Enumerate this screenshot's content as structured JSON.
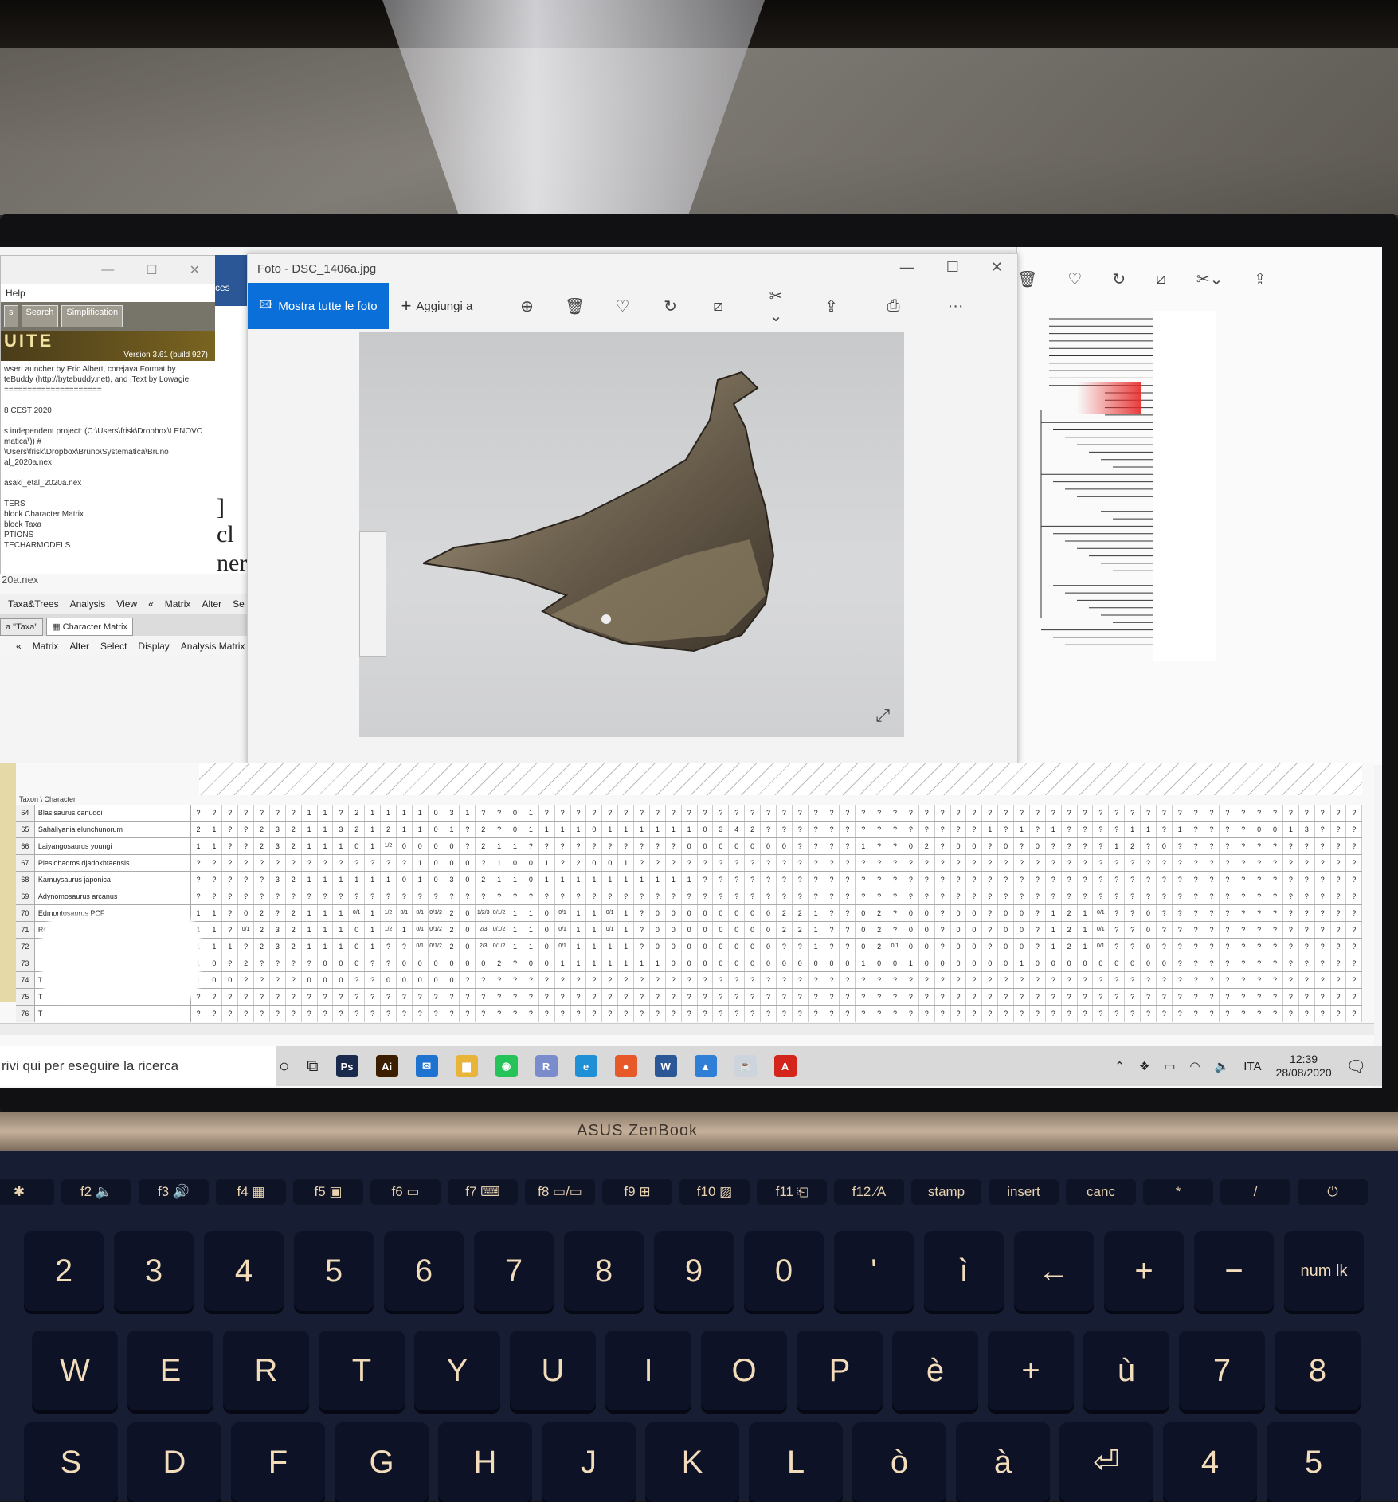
{
  "photo_viewer": {
    "title": "Foto - DSC_1406a.jpg",
    "show_all_label": "Mostra tutte le foto",
    "add_to_label": "Aggiungi a",
    "more": "···"
  },
  "mesquite": {
    "menu_help": "Help",
    "tabs": [
      "s",
      "Search",
      "Simplification"
    ],
    "banner": "UITE",
    "version": "Version 3.61  (build 927)",
    "log_lines": [
      "wserLauncher by Eric Albert,  corejava.Format by",
      "teBuddy (http://bytebuddy.net), and iText by Lowagie",
      "=====================",
      "",
      "8 CEST 2020",
      "",
      "s independent project: (C:\\Users\\frisk\\Dropbox\\LENOVO",
      "matica\\)) #",
      "\\Users\\frisk\\Dropbox\\Bruno\\Systematica\\Bruno",
      "al_2020a.nex",
      "",
      "asaki_etal_2020a.nex",
      "",
      "TERS",
      "block Character Matrix",
      "block Taxa",
      "PTIONS",
      "TECHARMODELS"
    ],
    "file_name": "20a.nex",
    "menubar": [
      "Taxa&Trees",
      "Analysis",
      "View",
      "«",
      "Matrix",
      "Alter",
      "Se"
    ],
    "tab_taxa": "a \"Taxa\"",
    "tab_matrix": "Character Matrix",
    "submenu": [
      "«",
      "Matrix",
      "Alter",
      "Select",
      "Display",
      "Analysis Matrix"
    ],
    "header": "Taxon \\ Character"
  },
  "word": {
    "ribbon_text": "ces",
    "fragments": [
      "] cl",
      "nera"
    ]
  },
  "matrix_rows": [
    {
      "num": "64",
      "taxon": "Blasisaurus canudoi",
      "cells": [
        "?",
        "?",
        "?",
        "?",
        "?",
        "?",
        "?",
        "1",
        "1",
        "?",
        "2",
        "1",
        "1",
        "1",
        "1",
        "0",
        "3",
        "1",
        "?",
        "?",
        "0",
        "1",
        "?",
        "?",
        "?",
        "?",
        "?",
        "?",
        "?",
        "?",
        "?",
        "?",
        "?",
        "?",
        "?",
        "?",
        "?",
        "?",
        "?",
        "?",
        "?",
        "?",
        "?",
        "?",
        "?",
        "?",
        "?",
        "?",
        "?",
        "?",
        "?",
        "?",
        "?",
        "?",
        "?",
        "?",
        "?",
        "?",
        "?",
        "?",
        "?",
        "?",
        "?",
        "?",
        "?",
        "?",
        "?",
        "?",
        "?",
        "?",
        "?",
        "?",
        "?",
        "?"
      ]
    },
    {
      "num": "65",
      "taxon": "Sahaliyania elunchunorum",
      "cells": [
        "2",
        "1",
        "?",
        "?",
        "2",
        "3",
        "2",
        "1",
        "1",
        "3",
        "2",
        "1",
        "2",
        "1",
        "1",
        "0",
        "1",
        "?",
        "2",
        "?",
        "0",
        "1",
        "1",
        "1",
        "1",
        "0",
        "1",
        "1",
        "1",
        "1",
        "1",
        "1",
        "0",
        "3",
        "4",
        "2",
        "?",
        "?",
        "?",
        "?",
        "?",
        "?",
        "?",
        "?",
        "?",
        "?",
        "?",
        "?",
        "?",
        "?",
        "1",
        "?",
        "1",
        "?",
        "1",
        "?",
        "?",
        "?",
        "?",
        "1",
        "1",
        "?",
        "1",
        "?",
        "?",
        "?",
        "?",
        "0",
        "0",
        "1",
        "3",
        "?",
        "?",
        "?"
      ]
    },
    {
      "num": "66",
      "taxon": "Laiyangosaurus youngi",
      "cells": [
        "1",
        "1",
        "?",
        "?",
        "2",
        "3",
        "2",
        "1",
        "1",
        "1",
        "0",
        "1",
        "1/2",
        "0",
        "0",
        "0",
        "0",
        "?",
        "2",
        "1",
        "1",
        "?",
        "?",
        "?",
        "?",
        "?",
        "?",
        "?",
        "?",
        "?",
        "?",
        "0",
        "0",
        "0",
        "0",
        "0",
        "0",
        "0",
        "?",
        "?",
        "?",
        "?",
        "1",
        "?",
        "?",
        "0",
        "2",
        "?",
        "0",
        "0",
        "?",
        "0",
        "?",
        "0",
        "?",
        "?",
        "?",
        "?",
        "1",
        "2",
        "?",
        "0",
        "?",
        "?",
        "?",
        "?",
        "?",
        "?",
        "?",
        "?",
        "?",
        "?",
        "?",
        "?"
      ]
    },
    {
      "num": "67",
      "taxon": "Plesiohadros djadokhtaensis",
      "cells": [
        "?",
        "?",
        "?",
        "?",
        "?",
        "?",
        "?",
        "?",
        "?",
        "?",
        "?",
        "?",
        "?",
        "?",
        "1",
        "0",
        "0",
        "0",
        "?",
        "1",
        "0",
        "0",
        "1",
        "?",
        "2",
        "0",
        "0",
        "1",
        "?",
        "?",
        "?",
        "?",
        "?",
        "?",
        "?",
        "?",
        "?",
        "?",
        "?",
        "?",
        "?",
        "?",
        "?",
        "?",
        "?",
        "?",
        "?",
        "?",
        "?",
        "?",
        "?",
        "?",
        "?",
        "?",
        "?",
        "?",
        "?",
        "?",
        "?",
        "?",
        "?",
        "?",
        "?",
        "?",
        "?",
        "?",
        "?",
        "?",
        "?",
        "?",
        "?",
        "?",
        "?",
        "?"
      ]
    },
    {
      "num": "68",
      "taxon": "Kamuysaurus japonica",
      "cells": [
        "?",
        "?",
        "?",
        "?",
        "?",
        "3",
        "2",
        "1",
        "1",
        "1",
        "1",
        "1",
        "1",
        "0",
        "1",
        "0",
        "3",
        "0",
        "2",
        "1",
        "1",
        "0",
        "1",
        "1",
        "1",
        "1",
        "1",
        "1",
        "1",
        "1",
        "1",
        "1",
        "?",
        "?",
        "?",
        "?",
        "?",
        "?",
        "?",
        "?",
        "?",
        "?",
        "?",
        "?",
        "?",
        "?",
        "?",
        "?",
        "?",
        "?",
        "?",
        "?",
        "?",
        "?",
        "?",
        "?",
        "?",
        "?",
        "?",
        "?",
        "?",
        "?",
        "?",
        "?",
        "?",
        "?",
        "?",
        "?",
        "?",
        "?",
        "?",
        "?",
        "?",
        "?"
      ]
    },
    {
      "num": "69",
      "taxon": "Adynomosaurus arcanus",
      "cells": [
        "?",
        "?",
        "?",
        "?",
        "?",
        "?",
        "?",
        "?",
        "?",
        "?",
        "?",
        "?",
        "?",
        "?",
        "?",
        "?",
        "?",
        "?",
        "?",
        "?",
        "?",
        "?",
        "?",
        "?",
        "?",
        "?",
        "?",
        "?",
        "?",
        "?",
        "?",
        "?",
        "?",
        "?",
        "?",
        "?",
        "?",
        "?",
        "?",
        "?",
        "?",
        "?",
        "?",
        "?",
        "?",
        "?",
        "?",
        "?",
        "?",
        "?",
        "?",
        "?",
        "?",
        "?",
        "?",
        "?",
        "?",
        "?",
        "?",
        "?",
        "?",
        "?",
        "?",
        "?",
        "?",
        "?",
        "?",
        "?",
        "?",
        "?",
        "?",
        "?",
        "?",
        "?"
      ]
    },
    {
      "num": "70",
      "taxon": "Edmontosaurus PCF",
      "cells": [
        "1",
        "1",
        "?",
        "0",
        "2",
        "?",
        "2",
        "1",
        "1",
        "1",
        "0/1",
        "1",
        "1/2",
        "0/1",
        "0/1",
        "0/1/2",
        "2",
        "0",
        "1/2/3",
        "0/1/2",
        "1",
        "1",
        "0",
        "0/1",
        "1",
        "1",
        "0/1",
        "1",
        "?",
        "0",
        "0",
        "0",
        "0",
        "0",
        "0",
        "0",
        "0",
        "2",
        "2",
        "1",
        "?",
        "?",
        "0",
        "2",
        "?",
        "0",
        "0",
        "?",
        "0",
        "0",
        "?",
        "0",
        "0",
        "?",
        "1",
        "2",
        "1",
        "0/1",
        "?",
        "?",
        "0",
        "?",
        "?",
        "?",
        "?",
        "?",
        "?",
        "?",
        "?",
        "?",
        "?",
        "?",
        "?",
        "?"
      ]
    },
    {
      "num": "71",
      "taxon": "ROM E annectens",
      "cells": [
        "1",
        "1",
        "?",
        "0/1",
        "2",
        "3",
        "2",
        "1",
        "1",
        "1",
        "0",
        "1",
        "1/2",
        "1",
        "0/1",
        "0/1/2",
        "2",
        "0",
        "2/3",
        "0/1/2",
        "1",
        "1",
        "0",
        "0/1",
        "1",
        "1",
        "0/1",
        "1",
        "?",
        "0",
        "0",
        "0",
        "0",
        "0",
        "0",
        "0",
        "0",
        "2",
        "2",
        "1",
        "?",
        "?",
        "0",
        "2",
        "?",
        "0",
        "0",
        "?",
        "0",
        "0",
        "?",
        "0",
        "0",
        "?",
        "1",
        "2",
        "1",
        "0/1",
        "?",
        "?",
        "0",
        "?",
        "?",
        "?",
        "?",
        "?",
        "?",
        "?",
        "?",
        "?",
        "?",
        "?",
        "?",
        "?"
      ]
    },
    {
      "num": "72",
      "taxon": "",
      "cells": [
        "1",
        "1",
        "1",
        "?",
        "2",
        "3",
        "2",
        "1",
        "1",
        "1",
        "0",
        "1",
        "?",
        "?",
        "0/1",
        "0/1/2",
        "2",
        "0",
        "2/3",
        "0/1/2",
        "1",
        "1",
        "0",
        "0/1",
        "1",
        "1",
        "1",
        "1",
        "?",
        "0",
        "0",
        "0",
        "0",
        "0",
        "0",
        "0",
        "0",
        "?",
        "?",
        "1",
        "?",
        "?",
        "0",
        "2",
        "0/1",
        "0",
        "0",
        "?",
        "0",
        "0",
        "?",
        "0",
        "0",
        "?",
        "1",
        "2",
        "1",
        "0/1",
        "?",
        "?",
        "0",
        "?",
        "?",
        "?",
        "?",
        "?",
        "?",
        "?",
        "?",
        "?",
        "?",
        "?",
        "?",
        "?"
      ]
    },
    {
      "num": "73",
      "taxon": "",
      "cells": [
        "1",
        "0",
        "?",
        "2",
        "?",
        "?",
        "?",
        "?",
        "0",
        "0",
        "0",
        "?",
        "?",
        "0",
        "0",
        "0",
        "0",
        "0",
        "0",
        "2",
        "?",
        "0",
        "0",
        "1",
        "1",
        "1",
        "1",
        "1",
        "1",
        "1",
        "0",
        "0",
        "0",
        "0",
        "0",
        "0",
        "0",
        "0",
        "0",
        "0",
        "0",
        "0",
        "1",
        "0",
        "0",
        "1",
        "0",
        "0",
        "0",
        "0",
        "0",
        "0",
        "1",
        "0",
        "0",
        "0",
        "0",
        "0",
        "0",
        "0",
        "0",
        "0",
        "?",
        "?",
        "?",
        "?",
        "?",
        "?",
        "?",
        "?",
        "?",
        "?",
        "?",
        "?"
      ]
    },
    {
      "num": "74",
      "taxon": "T",
      "cells": [
        "1",
        "0",
        "0",
        "?",
        "?",
        "?",
        "?",
        "0",
        "0",
        "0",
        "?",
        "?",
        "0",
        "0",
        "0",
        "0",
        "0",
        "?",
        "?",
        "?",
        "?",
        "?",
        "?",
        "?",
        "?",
        "?",
        "?",
        "?",
        "?",
        "?",
        "?",
        "?",
        "?",
        "?",
        "?",
        "?",
        "?",
        "?",
        "?",
        "?",
        "?",
        "?",
        "?",
        "?",
        "?",
        "?",
        "?",
        "?",
        "?",
        "?",
        "?",
        "?",
        "?",
        "?",
        "?",
        "?",
        "?",
        "?",
        "?",
        "?",
        "?",
        "?",
        "?",
        "?",
        "?",
        "?",
        "?",
        "?",
        "?",
        "?",
        "?",
        "?",
        "?",
        "?"
      ]
    },
    {
      "num": "75",
      "taxon": "T",
      "cells": [
        "?",
        "?",
        "?",
        "?",
        "?",
        "?",
        "?",
        "?",
        "?",
        "?",
        "?",
        "?",
        "?",
        "?",
        "?",
        "?",
        "?",
        "?",
        "?",
        "?",
        "?",
        "?",
        "?",
        "?",
        "?",
        "?",
        "?",
        "?",
        "?",
        "?",
        "?",
        "?",
        "?",
        "?",
        "?",
        "?",
        "?",
        "?",
        "?",
        "?",
        "?",
        "?",
        "?",
        "?",
        "?",
        "?",
        "?",
        "?",
        "?",
        "?",
        "?",
        "?",
        "?",
        "?",
        "?",
        "?",
        "?",
        "?",
        "?",
        "?",
        "?",
        "?",
        "?",
        "?",
        "?",
        "?",
        "?",
        "?",
        "?",
        "?",
        "?",
        "?",
        "?",
        "?"
      ]
    },
    {
      "num": "76",
      "taxon": "T",
      "cells": [
        "?",
        "?",
        "?",
        "?",
        "?",
        "?",
        "?",
        "?",
        "?",
        "?",
        "?",
        "?",
        "?",
        "?",
        "?",
        "?",
        "?",
        "?",
        "?",
        "?",
        "?",
        "?",
        "?",
        "?",
        "?",
        "?",
        "?",
        "?",
        "?",
        "?",
        "?",
        "?",
        "?",
        "?",
        "?",
        "?",
        "?",
        "?",
        "?",
        "?",
        "?",
        "?",
        "?",
        "?",
        "?",
        "?",
        "?",
        "?",
        "?",
        "?",
        "?",
        "?",
        "?",
        "?",
        "?",
        "?",
        "?",
        "?",
        "?",
        "?",
        "?",
        "?",
        "?",
        "?",
        "?",
        "?",
        "?",
        "?",
        "?",
        "?",
        "?",
        "?",
        "?",
        "?"
      ]
    }
  ],
  "taskbar": {
    "search_placeholder": "rivi qui per eseguire la ricerca",
    "apps": [
      {
        "name": "ps",
        "label": "Ps",
        "color": "#1a2a4d"
      },
      {
        "name": "ai",
        "label": "Ai",
        "color": "#3b1d00"
      },
      {
        "name": "mail",
        "label": "✉",
        "color": "#1e73d1"
      },
      {
        "name": "explorer",
        "label": "▆",
        "color": "#e8b43a"
      },
      {
        "name": "whatsapp",
        "label": "◉",
        "color": "#25c35a"
      },
      {
        "name": "r",
        "label": "R",
        "color": "#7a8ccc"
      },
      {
        "name": "edge",
        "label": "e",
        "color": "#1f8fd6"
      },
      {
        "name": "firefox",
        "label": "●",
        "color": "#e8592a"
      },
      {
        "name": "word",
        "label": "W",
        "color": "#2b5797"
      },
      {
        "name": "photos",
        "label": "▲",
        "color": "#2f7fd6"
      },
      {
        "name": "java",
        "label": "☕",
        "color": "#cdd4dc"
      },
      {
        "name": "acrobat",
        "label": "A",
        "color": "#d4251c"
      }
    ],
    "lang": "ITA",
    "time": "12:39",
    "date": "28/08/2020"
  },
  "laptop": {
    "brand": "ASUS ZenBook",
    "fkeys": [
      "✱",
      "f2 🔈",
      "f3 🔊",
      "f4 ▦",
      "f5 ▣",
      "f6 ▭",
      "f7 ⌨",
      "f8 ▭/▭",
      "f9 ⊞",
      "f10 ▨",
      "f11 ⎗",
      "f12 ⁄A",
      "stamp",
      "insert",
      "canc",
      "*",
      "/",
      "⏻"
    ],
    "row_numbers": [
      "2",
      "3",
      "4",
      "5",
      "6",
      "7",
      "8",
      "9",
      "0",
      "'",
      "ì",
      "←",
      "+",
      "−",
      "num lk"
    ],
    "row_qwerty": [
      "W",
      "E",
      "R",
      "T",
      "Y",
      "U",
      "I",
      "O",
      "P",
      "è",
      "+",
      "ù",
      "7",
      "8"
    ],
    "row_asdf": [
      "S",
      "D",
      "F",
      "G",
      "H",
      "J",
      "K",
      "L",
      "ò",
      "à",
      "⏎",
      "4",
      "5"
    ]
  }
}
